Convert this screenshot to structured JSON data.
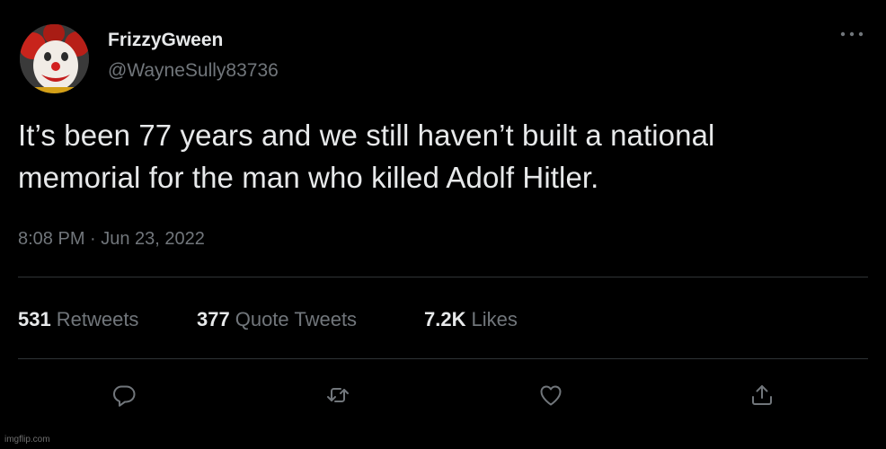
{
  "user": {
    "display_name": "FrizzyGween",
    "handle": "@WayneSully83736",
    "avatar_icon": "clown-avatar"
  },
  "tweet": {
    "text_lines": [
      "It’s been 77 years and we still haven’t built a national",
      "memorial for the man who killed Adolf Hitler."
    ],
    "timestamp": "8:08 PM · Jun 23, 2022"
  },
  "stats": {
    "retweets_count": "531",
    "retweets_label": "Retweets",
    "quotes_count": "377",
    "quotes_label": "Quote Tweets",
    "likes_count": "7.2K",
    "likes_label": "Likes"
  },
  "actions": [
    {
      "name": "reply",
      "icon": "reply-icon"
    },
    {
      "name": "retweet",
      "icon": "retweet-icon"
    },
    {
      "name": "like",
      "icon": "heart-icon"
    },
    {
      "name": "share",
      "icon": "share-icon"
    }
  ],
  "menu": {
    "icon": "more-icon"
  },
  "watermark": "imgflip.com",
  "colors": {
    "background": "#000000",
    "primary_text": "#e7e9ea",
    "secondary_text": "#71767b",
    "divider": "#2f3336"
  }
}
